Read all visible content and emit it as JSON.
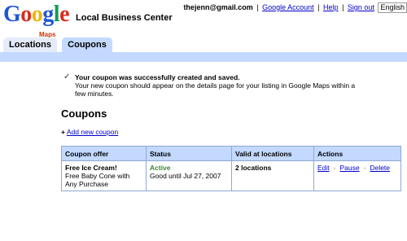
{
  "header": {
    "logo_text": "Google",
    "logo_sub": "Maps",
    "product_name": "Local Business Center",
    "user_email": "thejenn@gmail.com",
    "links": {
      "google_account": "Google Account",
      "help": "Help",
      "sign_out": "Sign out"
    },
    "separator": "|",
    "language": "English"
  },
  "tabs": [
    {
      "label": "Locations"
    },
    {
      "label": "Coupons",
      "active": true
    }
  ],
  "message": {
    "title": "Your coupon was successfully created and saved.",
    "body": "Your new coupon should appear on the details page for your listing in Google Maps within a few minutes."
  },
  "section_title": "Coupons",
  "add_link": "Add new coupon",
  "table": {
    "headers": [
      "Coupon offer",
      "Status",
      "Valid at locations",
      "Actions"
    ],
    "rows": [
      {
        "offer_title": "Free Ice Cream!",
        "offer_desc": "Free Baby Cone with Any Purchase",
        "status": "Active",
        "status_detail": "Good until Jul 27, 2007",
        "locations": "2 locations",
        "actions": [
          "Edit",
          "Pause",
          "Delete"
        ]
      }
    ]
  },
  "colors": {
    "tab_bar": "#c3d9ff",
    "link": "#0000cc",
    "active_status": "#3a8a3a"
  }
}
